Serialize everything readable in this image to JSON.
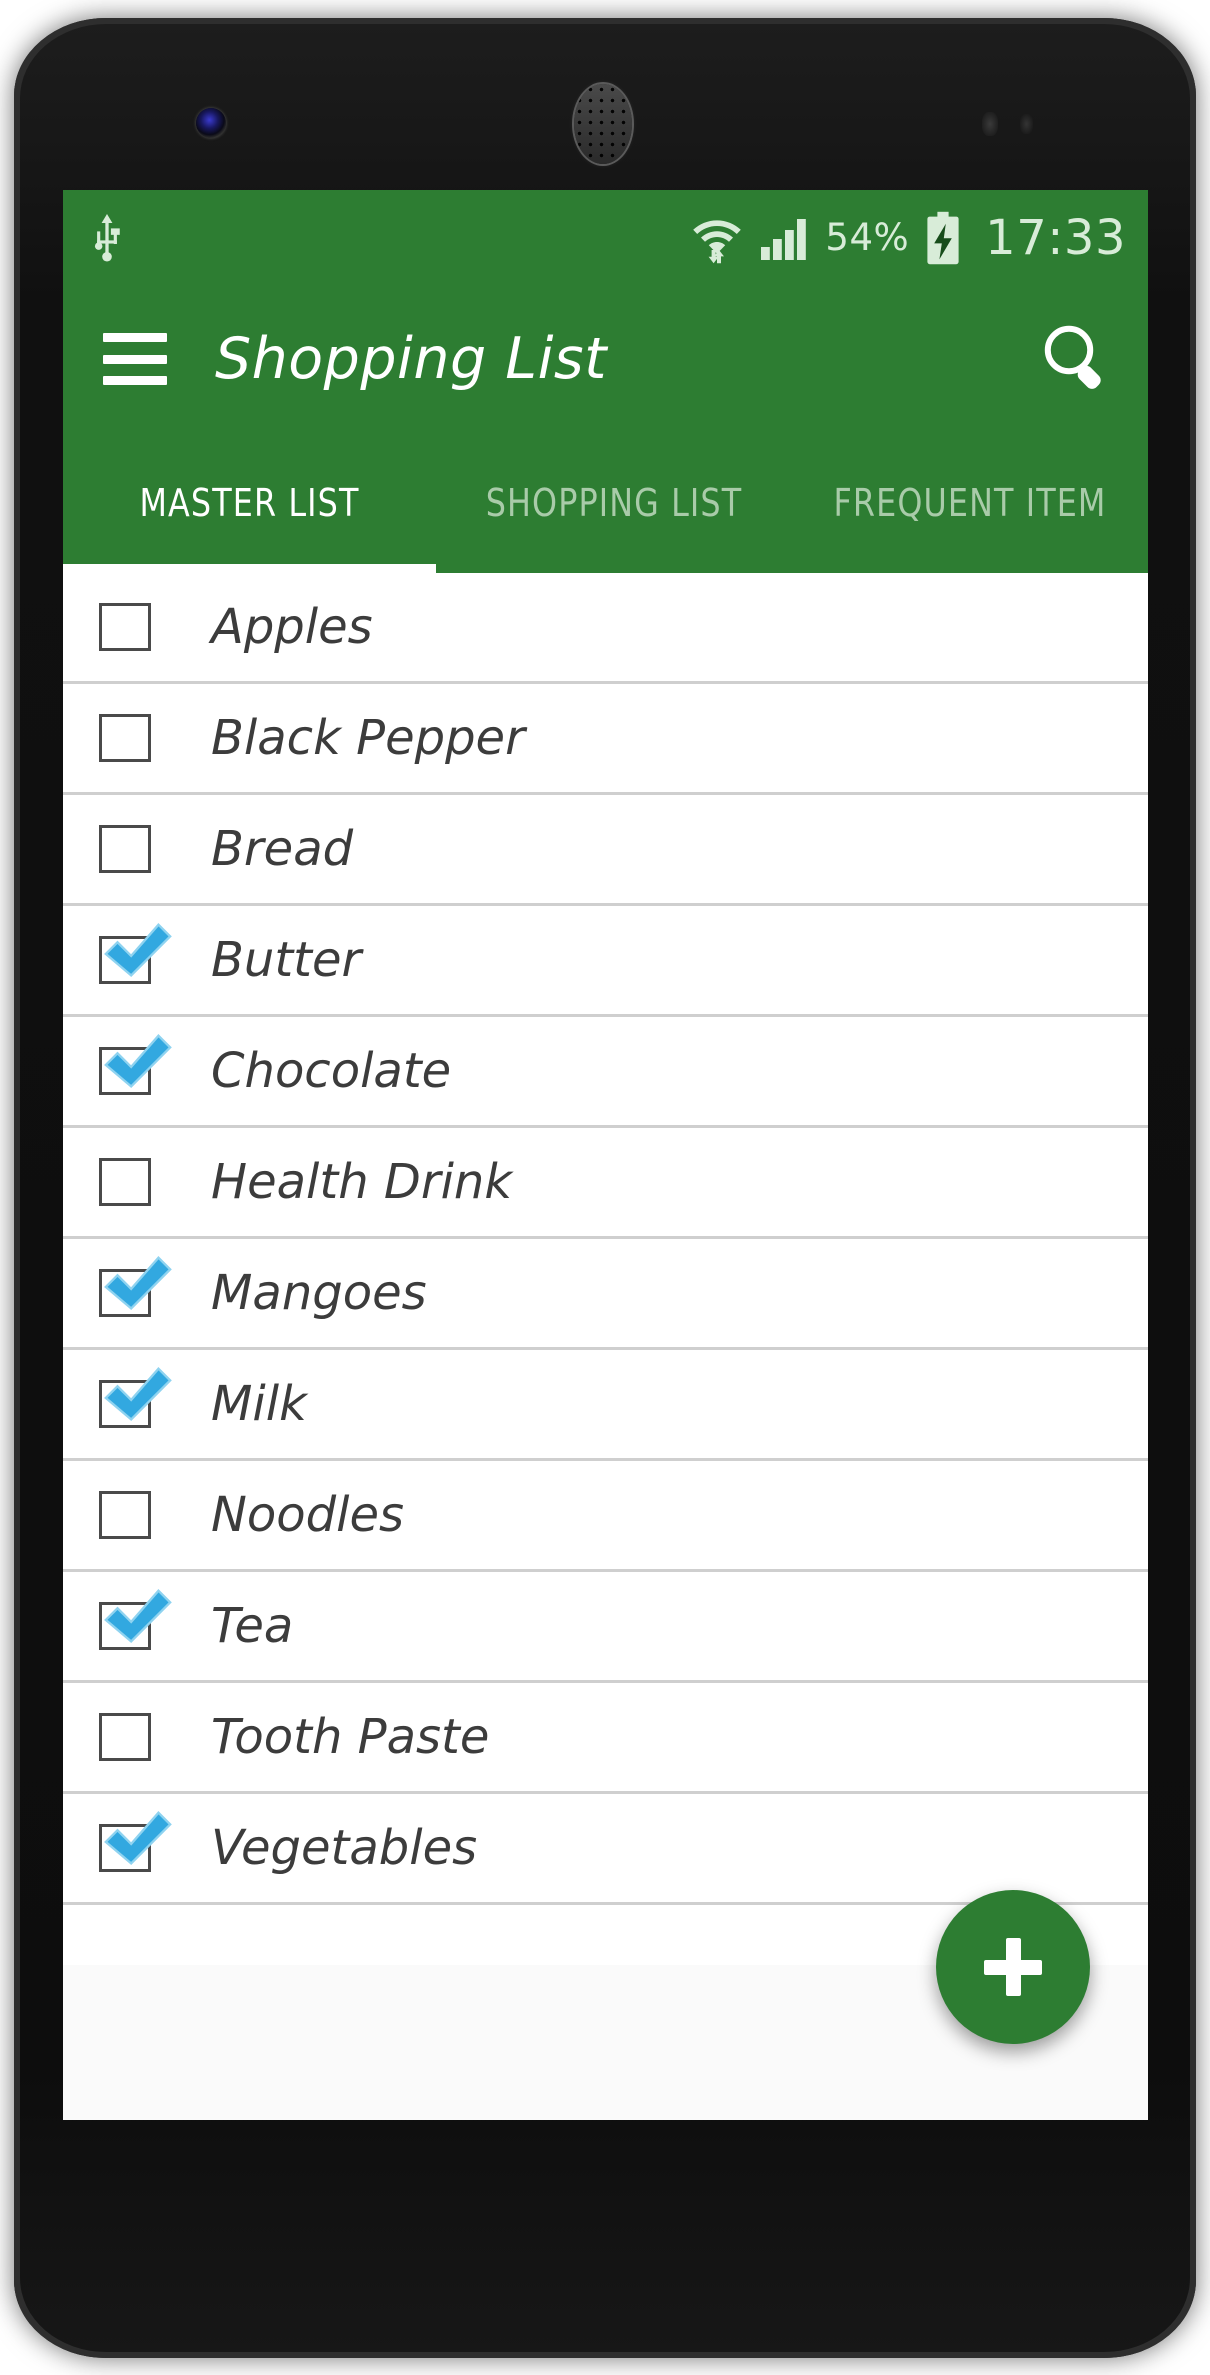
{
  "device": {
    "frame": "android-phone-mockup",
    "hardware": {
      "front_camera": "front-camera",
      "earpiece": "earpiece-speaker",
      "proximity_sensor": "proximity-sensor",
      "light_sensor": "light-sensor"
    }
  },
  "colors": {
    "primary_green": "#2d7d32",
    "status_text": "#d8ecd8",
    "checkbox_blue": "#32a8e0",
    "item_text": "#3c3c3c",
    "divider": "#cfcfcf"
  },
  "status_bar": {
    "usb_icon": "usb-icon",
    "wifi_icon": "wifi-icon",
    "signal_icon": "cellular-signal-icon",
    "battery_percent": "54%",
    "battery_icon": "battery-charging-icon",
    "clock": "17:33"
  },
  "app_bar": {
    "menu_icon": "hamburger-menu-icon",
    "title": "Shopping List",
    "search_icon": "search-icon"
  },
  "tabs": {
    "active_index": 0,
    "items": [
      {
        "label": "MASTER LIST",
        "active": true
      },
      {
        "label": "SHOPPING LIST",
        "active": false
      },
      {
        "label": "FREQUENT ITEM",
        "active": false
      }
    ]
  },
  "list": {
    "items": [
      {
        "label": "Apples",
        "checked": false
      },
      {
        "label": "Black Pepper",
        "checked": false
      },
      {
        "label": "Bread",
        "checked": false
      },
      {
        "label": "Butter",
        "checked": true
      },
      {
        "label": "Chocolate",
        "checked": true
      },
      {
        "label": "Health Drink",
        "checked": false
      },
      {
        "label": "Mangoes",
        "checked": true
      },
      {
        "label": "Milk",
        "checked": true
      },
      {
        "label": "Noodles",
        "checked": false
      },
      {
        "label": "Tea",
        "checked": true
      },
      {
        "label": "Tooth Paste",
        "checked": false
      },
      {
        "label": "Vegetables",
        "checked": true
      }
    ]
  },
  "fab": {
    "icon": "plus-icon",
    "label": "+"
  }
}
